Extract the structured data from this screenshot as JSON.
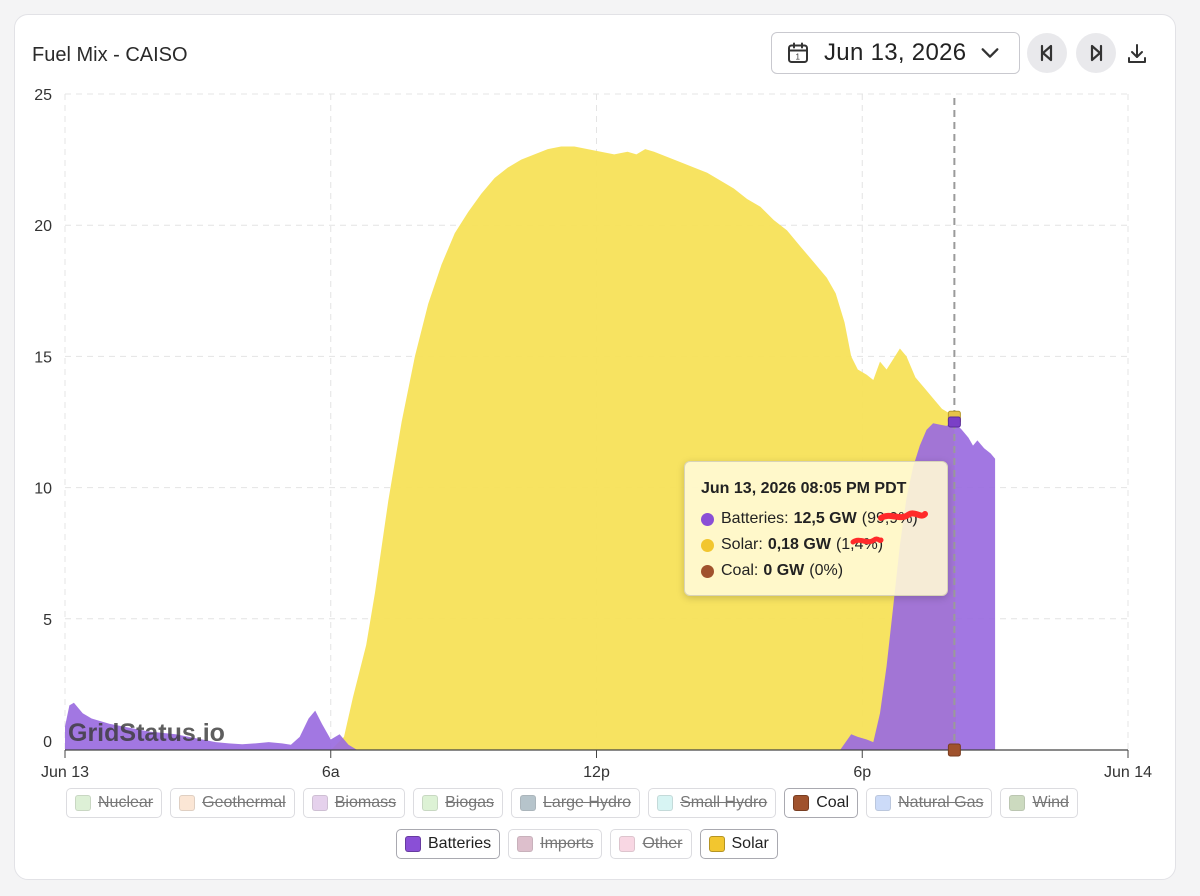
{
  "header": {
    "title": "Fuel Mix - CAISO",
    "date": "Jun 13, 2026"
  },
  "watermark": "GridStatus.io",
  "tooltip": {
    "title": "Jun 13, 2026 08:05 PM PDT",
    "rows": [
      {
        "name": "Batteries",
        "value": "12,5 GW",
        "pct": "(99,9%)",
        "color": "#8a4fd6"
      },
      {
        "name": "Solar",
        "value": "0,18 GW",
        "pct": "(1,4%)",
        "color": "#f2c62f"
      },
      {
        "name": "Coal",
        "value": "0 GW",
        "pct": "(0%)",
        "color": "#a0522d"
      }
    ]
  },
  "legend": [
    {
      "label": "Nuclear",
      "color": "#b6e0a6",
      "active": false
    },
    {
      "label": "Geothermal",
      "color": "#f7c9a3",
      "active": false
    },
    {
      "label": "Biomass",
      "color": "#c79ad6",
      "active": false
    },
    {
      "label": "Biogas",
      "color": "#b4e3a3",
      "active": false
    },
    {
      "label": "Large Hydro",
      "color": "#5f7d8d",
      "active": false
    },
    {
      "label": "Small Hydro",
      "color": "#a8e8e6",
      "active": false
    },
    {
      "label": "Coal",
      "color": "#a0522d",
      "active": true
    },
    {
      "label": "Natural Gas",
      "color": "#8fb0f0",
      "active": false
    },
    {
      "label": "Wind",
      "color": "#8faf72",
      "active": false
    },
    {
      "label": "Batteries",
      "color": "#8a4fd6",
      "active": true
    },
    {
      "label": "Imports",
      "color": "#b5728f",
      "active": false
    },
    {
      "label": "Other",
      "color": "#f0a8c3",
      "active": false
    },
    {
      "label": "Solar",
      "color": "#f2c62f",
      "active": true
    }
  ],
  "chart_data": {
    "type": "area",
    "title": "Fuel Mix - CAISO",
    "xlabel": "",
    "ylabel": "",
    "ylim": [
      0,
      25
    ],
    "xlim_hours": [
      0,
      24
    ],
    "y_ticks": [
      0,
      5,
      10,
      15,
      20,
      25
    ],
    "x_ticks": [
      {
        "hour": 0,
        "label": "Jun 13"
      },
      {
        "hour": 6,
        "label": "6a"
      },
      {
        "hour": 12,
        "label": "12p"
      },
      {
        "hour": 18,
        "label": "6p"
      },
      {
        "hour": 24,
        "label": "Jun 14"
      }
    ],
    "hover_hour": 20.08,
    "grid": true,
    "series": [
      {
        "name": "Batteries",
        "color": "#8a4fd6",
        "points": [
          [
            0.0,
            0.9
          ],
          [
            0.1,
            1.7
          ],
          [
            0.2,
            1.8
          ],
          [
            0.4,
            1.4
          ],
          [
            0.6,
            1.2
          ],
          [
            0.8,
            1.1
          ],
          [
            1.0,
            1.0
          ],
          [
            1.3,
            0.9
          ],
          [
            1.6,
            0.8
          ],
          [
            1.9,
            0.7
          ],
          [
            2.2,
            0.65
          ],
          [
            2.5,
            0.6
          ],
          [
            2.8,
            0.5
          ],
          [
            3.1,
            0.4
          ],
          [
            3.4,
            0.3
          ],
          [
            3.7,
            0.25
          ],
          [
            4.0,
            0.22
          ],
          [
            4.3,
            0.25
          ],
          [
            4.6,
            0.3
          ],
          [
            4.9,
            0.25
          ],
          [
            5.1,
            0.2
          ],
          [
            5.3,
            0.5
          ],
          [
            5.5,
            1.2
          ],
          [
            5.65,
            1.5
          ],
          [
            5.8,
            1.0
          ],
          [
            6.0,
            0.4
          ],
          [
            6.2,
            0.6
          ],
          [
            6.4,
            0.2
          ],
          [
            6.6,
            0.0
          ],
          [
            17.5,
            0.0
          ],
          [
            17.75,
            0.6
          ],
          [
            17.9,
            0.5
          ],
          [
            18.1,
            0.4
          ],
          [
            18.25,
            0.3
          ],
          [
            18.4,
            1.4
          ],
          [
            18.55,
            3.2
          ],
          [
            18.7,
            5.5
          ],
          [
            18.85,
            7.8
          ],
          [
            19.0,
            9.6
          ],
          [
            19.15,
            10.8
          ],
          [
            19.3,
            11.6
          ],
          [
            19.45,
            12.2
          ],
          [
            19.6,
            12.45
          ],
          [
            19.75,
            12.4
          ],
          [
            19.9,
            12.35
          ],
          [
            20.08,
            12.5
          ],
          [
            20.25,
            12.2
          ],
          [
            20.4,
            11.9
          ],
          [
            20.5,
            11.6
          ],
          [
            20.6,
            11.8
          ],
          [
            20.75,
            11.5
          ],
          [
            20.9,
            11.3
          ],
          [
            21.0,
            11.1
          ]
        ]
      },
      {
        "name": "Solar",
        "color": "#f2c62f",
        "points": [
          [
            6.0,
            0.0
          ],
          [
            6.3,
            0.5
          ],
          [
            6.5,
            2.0
          ],
          [
            6.8,
            4.0
          ],
          [
            7.0,
            6.0
          ],
          [
            7.3,
            9.5
          ],
          [
            7.6,
            12.5
          ],
          [
            7.9,
            15.0
          ],
          [
            8.2,
            17.0
          ],
          [
            8.5,
            18.5
          ],
          [
            8.8,
            19.7
          ],
          [
            9.1,
            20.5
          ],
          [
            9.4,
            21.2
          ],
          [
            9.7,
            21.8
          ],
          [
            10.0,
            22.2
          ],
          [
            10.3,
            22.5
          ],
          [
            10.6,
            22.7
          ],
          [
            10.9,
            22.9
          ],
          [
            11.2,
            23.0
          ],
          [
            11.5,
            23.0
          ],
          [
            11.8,
            22.9
          ],
          [
            12.1,
            22.8
          ],
          [
            12.4,
            22.7
          ],
          [
            12.7,
            22.8
          ],
          [
            12.9,
            22.7
          ],
          [
            13.1,
            22.9
          ],
          [
            13.3,
            22.8
          ],
          [
            13.6,
            22.6
          ],
          [
            13.9,
            22.4
          ],
          [
            14.2,
            22.2
          ],
          [
            14.5,
            22.0
          ],
          [
            14.8,
            21.7
          ],
          [
            15.1,
            21.4
          ],
          [
            15.4,
            21.0
          ],
          [
            15.7,
            20.7
          ],
          [
            16.0,
            20.2
          ],
          [
            16.3,
            19.8
          ],
          [
            16.6,
            19.2
          ],
          [
            16.9,
            18.6
          ],
          [
            17.2,
            18.0
          ],
          [
            17.4,
            17.4
          ],
          [
            17.6,
            16.3
          ],
          [
            17.75,
            15.0
          ],
          [
            17.9,
            14.5
          ],
          [
            18.1,
            14.3
          ],
          [
            18.25,
            14.1
          ],
          [
            18.4,
            14.8
          ],
          [
            18.55,
            14.5
          ],
          [
            18.7,
            14.9
          ],
          [
            18.85,
            15.3
          ],
          [
            19.0,
            15.0
          ],
          [
            19.2,
            14.2
          ],
          [
            19.4,
            13.8
          ],
          [
            19.6,
            13.4
          ],
          [
            19.8,
            13.0
          ],
          [
            20.0,
            12.8
          ],
          [
            20.08,
            12.68
          ],
          [
            20.12,
            0.0
          ]
        ]
      },
      {
        "name": "Coal",
        "color": "#a0522d",
        "points": [
          [
            0,
            0
          ],
          [
            24,
            0
          ]
        ]
      }
    ]
  }
}
